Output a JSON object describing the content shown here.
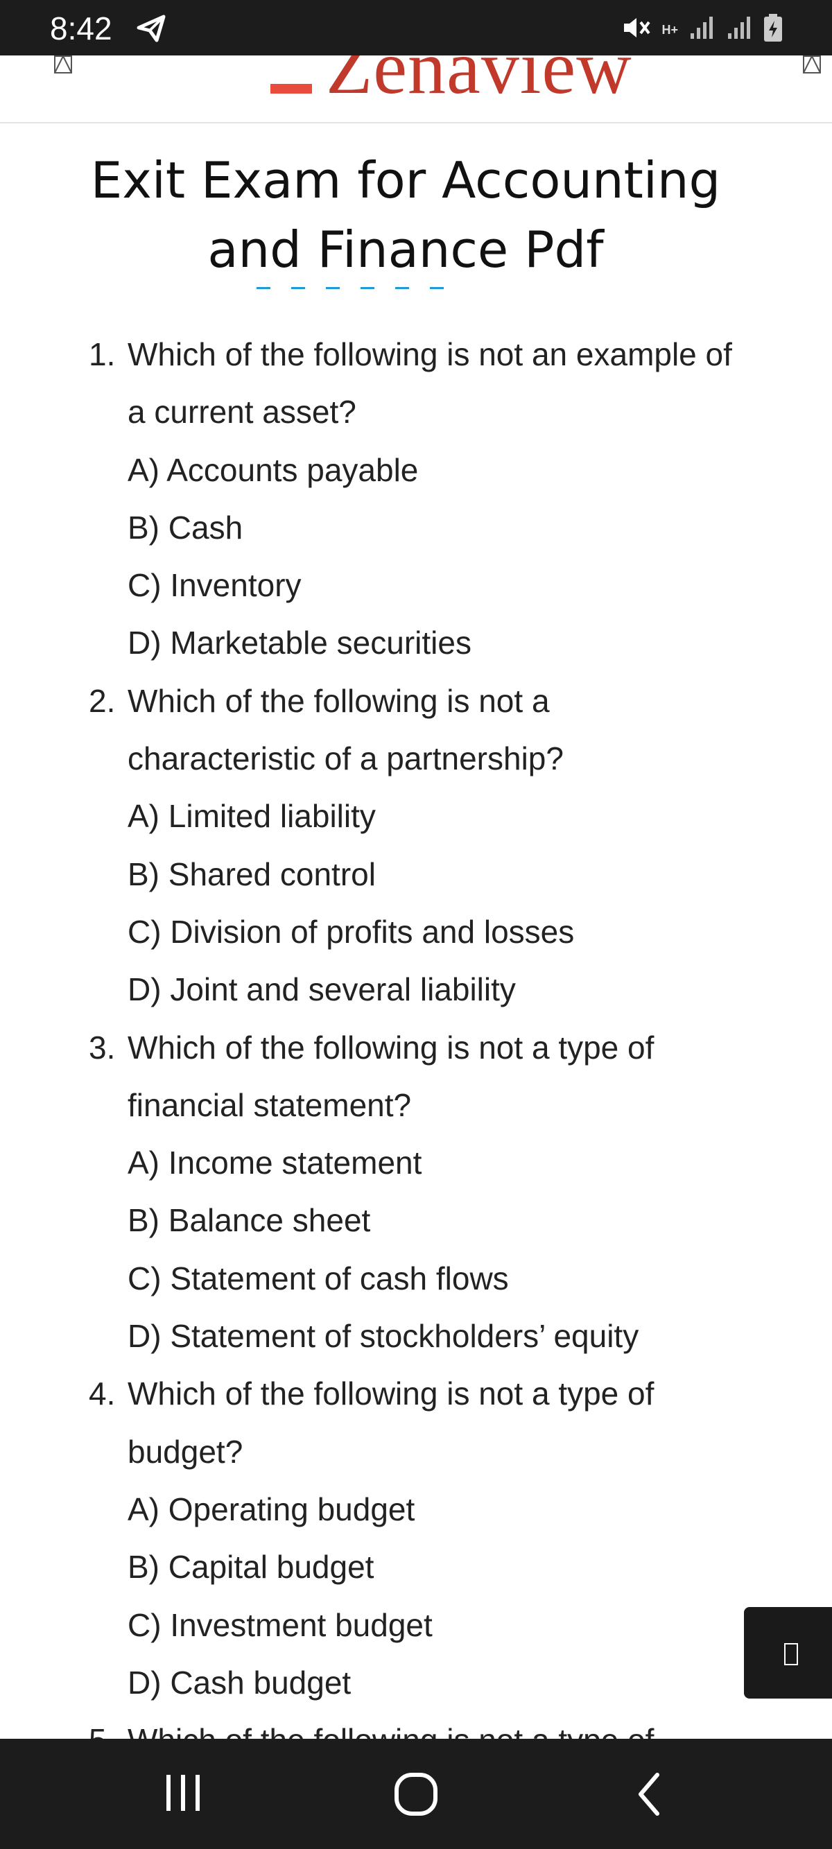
{
  "status_bar": {
    "time": "8:42",
    "icons": [
      "telegram-icon",
      "mute-icon",
      "hplus-data-icon",
      "signal-icon",
      "signal-icon",
      "battery-charging-icon"
    ],
    "network_label": "H+"
  },
  "header": {
    "logo_text": "Zenaview",
    "left_icon": "broken-image-icon",
    "right_icon": "broken-image-icon"
  },
  "article": {
    "title_line1": "Exit Exam for Accounting",
    "title_line2": "and Finance Pdf",
    "questions": [
      {
        "number": "1.",
        "text_line1": "Which of the following is not an example of",
        "text_line2": "a current asset?",
        "options": [
          "A) Accounts payable",
          "B) Cash",
          "C) Inventory",
          "D) Marketable securities"
        ]
      },
      {
        "number": "2.",
        "text_line1": "Which of the following is not a",
        "text_line2": "characteristic of a partnership?",
        "options": [
          "A) Limited liability",
          "B) Shared control",
          "C) Division of profits and losses",
          "D) Joint and several liability"
        ]
      },
      {
        "number": "3.",
        "text_line1": "Which of the following is not a type of",
        "text_line2": "financial statement?",
        "options": [
          "A) Income statement",
          "B) Balance sheet",
          "C) Statement of cash flows",
          "D) Statement of stockholders’ equity"
        ]
      },
      {
        "number": "4.",
        "text_line1": "Which of the following is not a type of",
        "text_line2": "budget?",
        "options": [
          "A) Operating budget",
          "B) Capital budget",
          "C) Investment budget",
          "D) Cash budget"
        ]
      },
      {
        "number": "5.",
        "text_line1": "Which of the following is not a type of",
        "text_line2": "",
        "options": []
      }
    ]
  },
  "floating_button": {
    "icon": "broken-glyph-icon"
  },
  "nav_bar": {
    "buttons": [
      "recents-icon",
      "home-icon",
      "back-icon"
    ]
  },
  "colors": {
    "status_bar": "#1c1c1c",
    "logo": "#c0392b",
    "accent_underline": "#1e9ad6",
    "text": "#222222"
  }
}
